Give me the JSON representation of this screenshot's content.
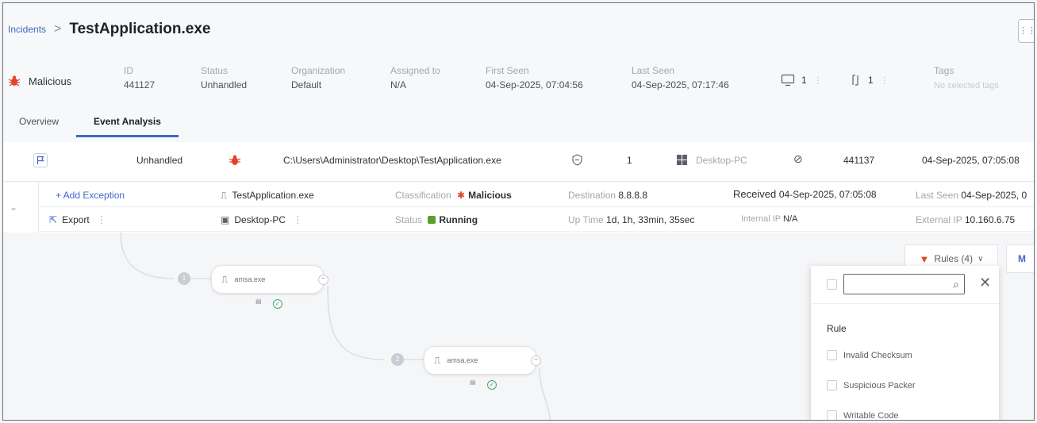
{
  "breadcrumb": {
    "parent": "Incidents",
    "separator": ">",
    "title": "TestApplication.exe"
  },
  "header": {
    "classification": "Malicious",
    "fields": [
      {
        "label": "ID",
        "value": "441127"
      },
      {
        "label": "Status",
        "value": "Unhandled"
      },
      {
        "label": "Organization",
        "value": "Default"
      },
      {
        "label": "Assigned to",
        "value": "N/A"
      },
      {
        "label": "First Seen",
        "value": "04-Sep-2025, 07:04:56"
      },
      {
        "label": "Last Seen",
        "value": "04-Sep-2025, 07:17:46"
      }
    ],
    "devices_count": "1",
    "processes_count": "1",
    "tags_label": "Tags",
    "tags_placeholder": "No selected tags"
  },
  "tabs": [
    {
      "label": "Overview"
    },
    {
      "label": "Event Analysis"
    }
  ],
  "event": {
    "status": "Unhandled",
    "path": "C:\\Users\\Administrator\\Desktop\\TestApplication.exe",
    "count": "1",
    "device": "Desktop-PC",
    "id": "441137",
    "timestamp": "04-Sep-2025, 07:05:08"
  },
  "detail": {
    "add_exception": "+ Add Exception",
    "export": "Export",
    "process": "TestApplication.exe",
    "device": "Desktop-PC",
    "classification_label": "Classification",
    "classification_value": "Malicious",
    "status_label": "Status",
    "status_value": "Running",
    "destination_label": "Destination",
    "destination_value": "8.8.8.8",
    "uptime_label": "Up Time",
    "uptime_value": "1d, 1h, 33min, 35sec",
    "received_label": "Received",
    "received_value": "04-Sep-2025, 07:05:08",
    "internal_ip_label": "Internal IP",
    "internal_ip_value": "N/A",
    "last_seen_label": "Last Seen",
    "last_seen_value": "04-Sep-2025, 0",
    "external_ip_label": "External IP",
    "external_ip_value": "10.160.6.75"
  },
  "graph": {
    "nodes": [
      {
        "step": "1",
        "label": "amsa.exe"
      },
      {
        "step": "2",
        "label": "amsa.exe"
      }
    ]
  },
  "rules": {
    "button_label": "Rules (4)",
    "m_label": "M",
    "header": "Rule",
    "options": [
      "Invalid Checksum",
      "Suspicious Packer",
      "Writable Code"
    ]
  },
  "colors": {
    "accent": "#3f67c8",
    "malicious": "#e0452a",
    "running": "#5aa02c"
  }
}
